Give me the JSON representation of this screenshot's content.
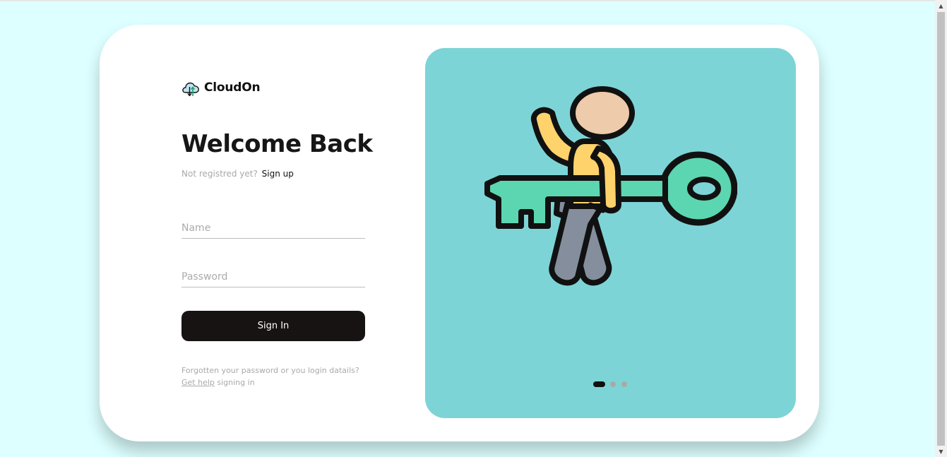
{
  "brand": {
    "name": "CloudOn",
    "icon": "cloud-sync-icon"
  },
  "login": {
    "title": "Welcome Back",
    "subtitle_text": "Not registred yet?",
    "signup_link": "Sign up",
    "name_placeholder": "Name",
    "password_placeholder": "Password",
    "signin_label": "Sign In",
    "help_text": "Forgotten your password or you login datails?",
    "help_link": "Get help",
    "help_suffix": " signing in"
  },
  "hero": {
    "illustration": "person-with-key-illustration",
    "carousel_count": 3,
    "carousel_active": 1
  },
  "colors": {
    "page_background": "#ddffff",
    "card_background": "#ffffff",
    "hero_background": "#7dd4d6",
    "button_background": "#171313",
    "key_color": "#5cd6b0",
    "shirt_color": "#ffd36b",
    "skin_color": "#eecbaa",
    "pants_color": "#848e9c"
  }
}
